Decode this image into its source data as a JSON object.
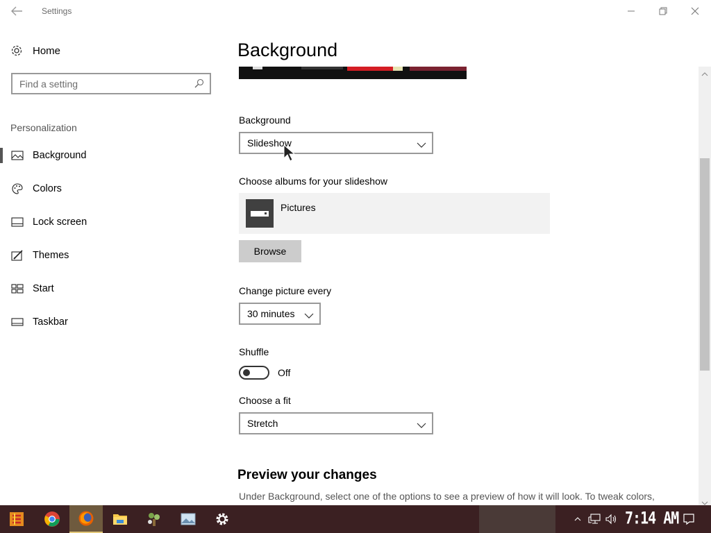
{
  "window": {
    "title": "Settings",
    "back_icon": "back-arrow-icon",
    "controls": [
      "minimize-icon",
      "restore-icon",
      "close-icon"
    ]
  },
  "sidebar": {
    "home_label": "Home",
    "search_placeholder": "Find a setting",
    "section_label": "Personalization",
    "items": [
      {
        "label": "Background",
        "icon": "picture-icon",
        "active": true
      },
      {
        "label": "Colors",
        "icon": "palette-icon",
        "active": false
      },
      {
        "label": "Lock screen",
        "icon": "lock-screen-icon",
        "active": false
      },
      {
        "label": "Themes",
        "icon": "themes-icon",
        "active": false
      },
      {
        "label": "Start",
        "icon": "start-icon",
        "active": false
      },
      {
        "label": "Taskbar",
        "icon": "taskbar-icon",
        "active": false
      }
    ]
  },
  "main": {
    "page_title": "Background",
    "background": {
      "label": "Background",
      "value": "Slideshow"
    },
    "albums": {
      "label": "Choose albums for your slideshow",
      "album_name": "Pictures",
      "browse_label": "Browse"
    },
    "interval": {
      "label": "Change picture every",
      "value": "30 minutes"
    },
    "shuffle": {
      "label": "Shuffle",
      "state_label": "Off",
      "on": false
    },
    "fit": {
      "label": "Choose a fit",
      "value": "Stretch"
    },
    "preview": {
      "heading": "Preview your changes",
      "description": "Under Background, select one of the options to see a preview of how it will look. To tweak colors,"
    }
  },
  "taskbar": {
    "apps": [
      "start-icon",
      "chrome-icon",
      "firefox-icon",
      "file-explorer-icon",
      "game-icon",
      "photos-icon",
      "settings-icon"
    ],
    "active_app": "firefox-icon",
    "tray_icons": [
      "show-hidden-icons-icon",
      "network-icon",
      "volume-icon"
    ],
    "clock": "7:14 AM",
    "action_center_icon": "action-center-icon"
  },
  "colors": {
    "taskbar_bg": "#3b2022",
    "album_tile": "#404040",
    "browse_bg": "#cccccc"
  }
}
